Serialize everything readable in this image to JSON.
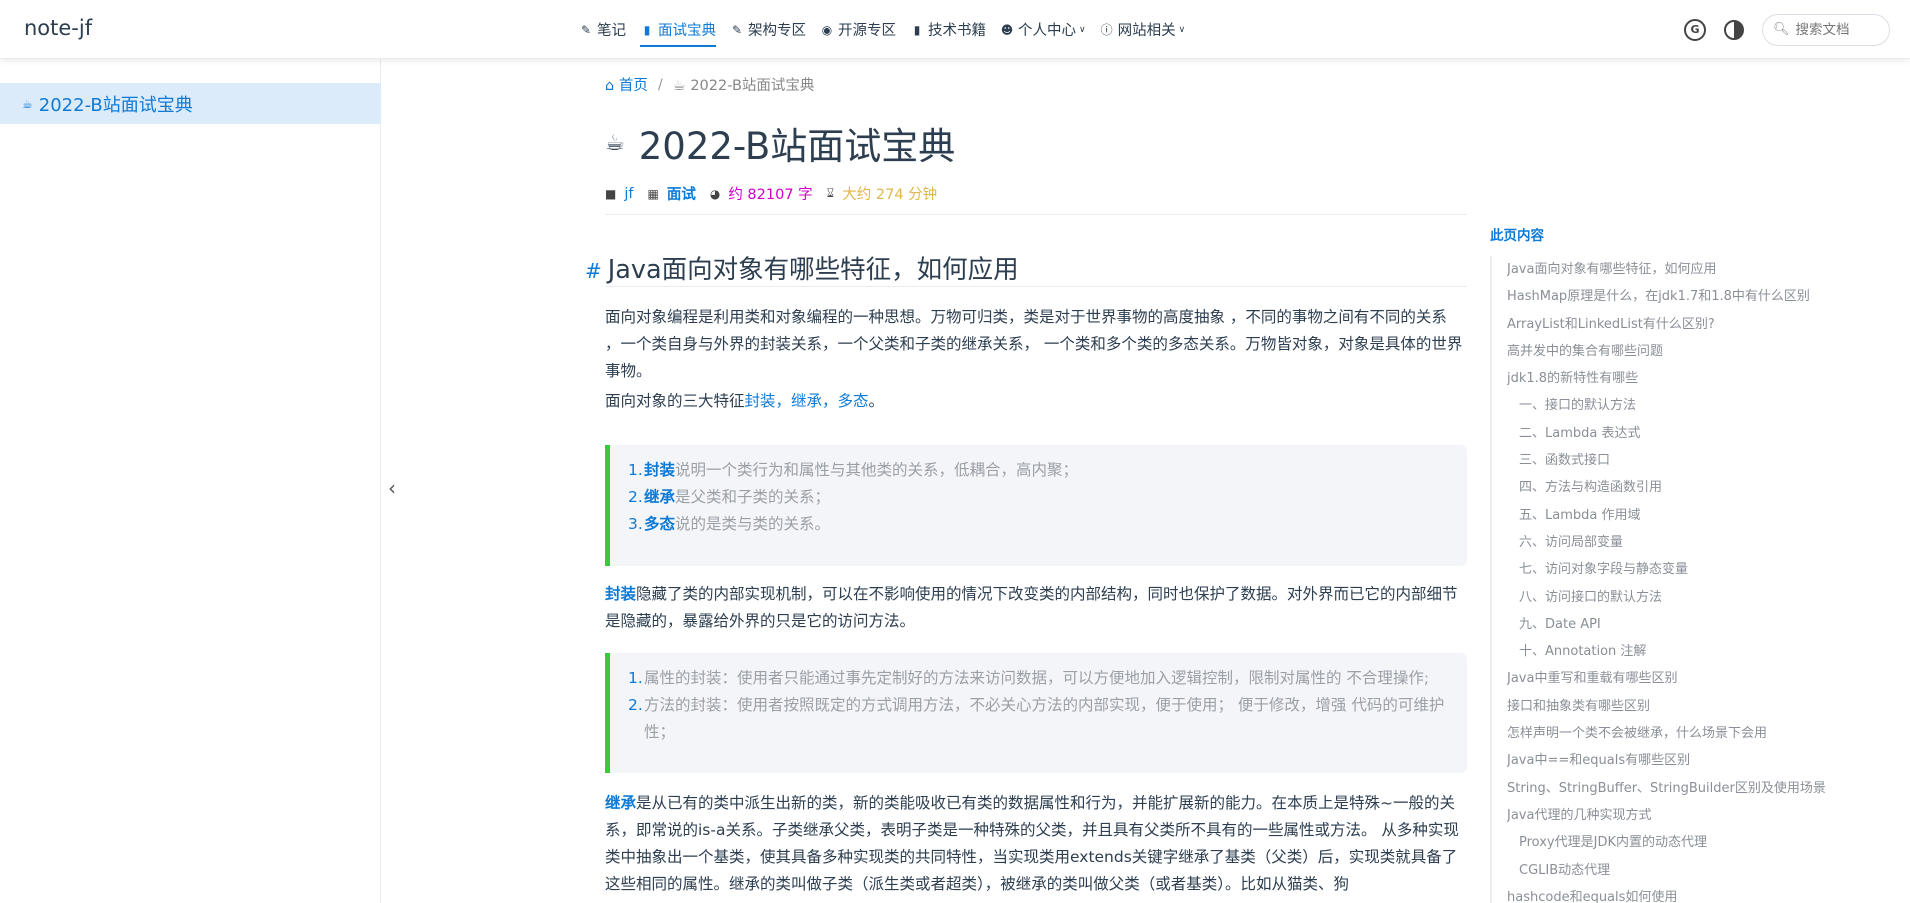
{
  "site": {
    "brand": "note-jf"
  },
  "nav": {
    "items": [
      {
        "label": "笔记",
        "icon": "pencil-icon",
        "glyph": "✎",
        "active": false,
        "dropdown": false
      },
      {
        "label": "面试宝典",
        "icon": "book-icon",
        "glyph": "▮",
        "active": true,
        "dropdown": false
      },
      {
        "label": "架构专区",
        "icon": "pencil-icon",
        "glyph": "✎",
        "active": false,
        "dropdown": false
      },
      {
        "label": "开源专区",
        "icon": "github-icon",
        "glyph": "◉",
        "active": false,
        "dropdown": false
      },
      {
        "label": "技术书籍",
        "icon": "book-icon",
        "glyph": "▮",
        "active": false,
        "dropdown": false
      },
      {
        "label": "个人中心",
        "icon": "user-icon",
        "glyph": "☻",
        "active": false,
        "dropdown": true
      },
      {
        "label": "网站相关",
        "icon": "info-icon",
        "glyph": "ⓘ",
        "active": false,
        "dropdown": true
      }
    ],
    "search_placeholder": "搜索文档",
    "accent": "#0e7ad6"
  },
  "sidebar": {
    "active_item": "2022-B站面试宝典"
  },
  "breadcrumb": {
    "home": "首页",
    "separator": "/",
    "current": "2022-B站面试宝典"
  },
  "page": {
    "title": "2022-B站面试宝典",
    "author": "jf",
    "category": "面试",
    "word_count": "约 82107 字",
    "read_time": "大约 274 分钟"
  },
  "article": {
    "h2": "Java面向对象有哪些特征，如何应用",
    "p1": "面向对象编程是利用类和对象编程的一种思想。万物可归类，类是对于世界事物的高度抽象 ，不同的事物之间有不同的关系 ，一个类自身与外界的封装关系，一个父类和子类的继承关系， 一个类和多个类的多态关系。万物皆对象，对象是具体的世界事物。",
    "p2_prefix": "面向对象的三大特征",
    "p2_highlight": "封装，继承，多态",
    "p2_suffix": "。",
    "quote1": [
      {
        "num": "1.",
        "term": "封装",
        "text": "说明一个类行为和属性与其他类的关系，低耦合，高内聚；"
      },
      {
        "num": "2.",
        "term": "继承",
        "text": "是父类和子类的关系；"
      },
      {
        "num": "3.",
        "term": "多态",
        "text": "说的是类与类的关系。"
      }
    ],
    "p3_term": "封装",
    "p3_text": "隐藏了类的内部实现机制，可以在不影响使用的情况下改变类的内部结构，同时也保护了数据。对外界而已它的内部细节是隐藏的，暴露给外界的只是它的访问方法。",
    "quote2": [
      {
        "num": "1.",
        "text": "属性的封装：使用者只能通过事先定制好的方法来访问数据，可以方便地加入逻辑控制，限制对属性的 不合理操作;"
      },
      {
        "num": "2.",
        "text": "方法的封装：使用者按照既定的方式调用方法，不必关心方法的内部实现，便于使用； 便于修改，增强 代码的可维护性；"
      }
    ],
    "p4_term": "继承",
    "p4_text": "是从已有的类中派生出新的类，新的类能吸收已有类的数据属性和行为，并能扩展新的能力。在本质上是特殊~一般的关系，即常说的is-a关系。子类继承父类，表明子类是一种特殊的父类，并且具有父类所不具有的一些属性或方法。 从多种实现类中抽象出一个基类，使其具备多种实现类的共同特性，当实现类用extends关键字继承了基类（父类）后，实现类就具备了这些相同的属性。继承的类叫做子类（派生类或者超类），被继承的类叫做父类（或者基类）。比如从猫类、狗"
  },
  "toc": {
    "title": "此页内容",
    "items": [
      {
        "label": "Java面向对象有哪些特征，如何应用",
        "level": 1
      },
      {
        "label": "HashMap原理是什么，在jdk1.7和1.8中有什么区别",
        "level": 1
      },
      {
        "label": "ArrayList和LinkedList有什么区别?",
        "level": 1
      },
      {
        "label": "高并发中的集合有哪些问题",
        "level": 1
      },
      {
        "label": "jdk1.8的新特性有哪些",
        "level": 1
      },
      {
        "label": "一、接口的默认方法",
        "level": 2
      },
      {
        "label": "二、Lambda 表达式",
        "level": 2
      },
      {
        "label": "三、函数式接口",
        "level": 2
      },
      {
        "label": "四、方法与构造函数引用",
        "level": 2
      },
      {
        "label": "五、Lambda 作用域",
        "level": 2
      },
      {
        "label": "六、访问局部变量",
        "level": 2
      },
      {
        "label": "七、访问对象字段与静态变量",
        "level": 2
      },
      {
        "label": "八、访问接口的默认方法",
        "level": 2
      },
      {
        "label": "九、Date API",
        "level": 2
      },
      {
        "label": "十、Annotation 注解",
        "level": 2
      },
      {
        "label": "Java中重写和重载有哪些区别",
        "level": 1
      },
      {
        "label": "接口和抽象类有哪些区别",
        "level": 1
      },
      {
        "label": "怎样声明一个类不会被继承，什么场景下会用",
        "level": 1
      },
      {
        "label": "Java中==和equals有哪些区别",
        "level": 1
      },
      {
        "label": "String、StringBuffer、StringBuilder区别及使用场景",
        "level": 1
      },
      {
        "label": "Java代理的几种实现方式",
        "level": 1
      },
      {
        "label": "Proxy代理是JDK内置的动态代理",
        "level": 2
      },
      {
        "label": "CGLIB动态代理",
        "level": 2
      },
      {
        "label": "hashcode和equals如何使用",
        "level": 1
      }
    ]
  }
}
